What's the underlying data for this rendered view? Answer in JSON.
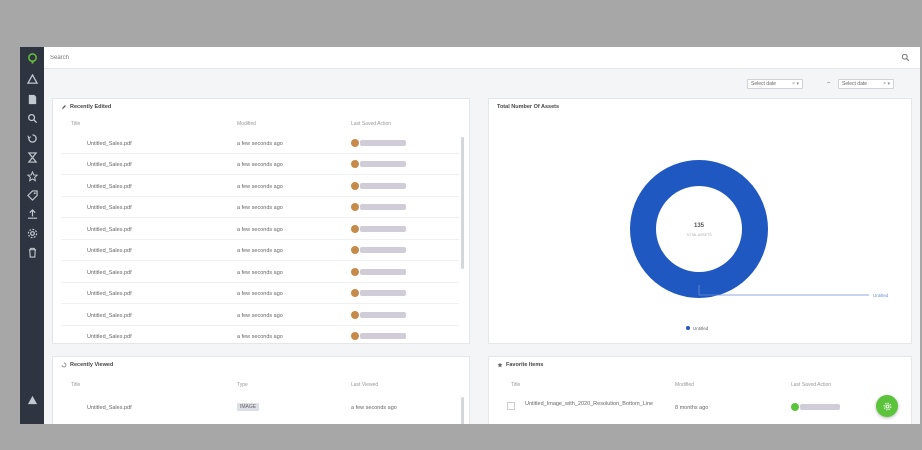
{
  "search": {
    "placeholder": "Search"
  },
  "filters": {
    "from": "Select date",
    "separator": "–",
    "to": "Select date"
  },
  "recently_edited": {
    "title": "Recently Edited",
    "columns": [
      "Title",
      "Modified",
      "Last Saved Action"
    ],
    "rows": [
      {
        "title": "Untitled_Sales.pdf",
        "modified": "a few seconds ago"
      },
      {
        "title": "Untitled_Sales.pdf",
        "modified": "a few seconds ago"
      },
      {
        "title": "Untitled_Sales.pdf",
        "modified": "a few seconds ago"
      },
      {
        "title": "Untitled_Sales.pdf",
        "modified": "a few seconds ago"
      },
      {
        "title": "Untitled_Sales.pdf",
        "modified": "a few seconds ago"
      },
      {
        "title": "Untitled_Sales.pdf",
        "modified": "a few seconds ago"
      },
      {
        "title": "Untitled_Sales.pdf",
        "modified": "a few seconds ago"
      },
      {
        "title": "Untitled_Sales.pdf",
        "modified": "a few seconds ago"
      },
      {
        "title": "Untitled_Sales.pdf",
        "modified": "a few seconds ago"
      },
      {
        "title": "Untitled_Sales.pdf",
        "modified": "a few seconds ago"
      }
    ]
  },
  "donut": {
    "title": "Total Number Of Assets",
    "center_value": "135",
    "center_label": "TOTAL ASSETS",
    "callout_label": "Untitled",
    "legend": "Untitled",
    "colors": {
      "ring": "#1f58c1",
      "line": "#6a8fd6"
    }
  },
  "recently_viewed": {
    "title": "Recently Viewed",
    "columns": [
      "Title",
      "Type",
      "Last Viewed"
    ],
    "rows": [
      {
        "title": "Untitled_Sales.pdf",
        "type": "IMAGE",
        "last_viewed": "a few seconds ago"
      }
    ]
  },
  "favorite_items": {
    "title": "Favorite Items",
    "columns": [
      "Title",
      "Modified",
      "Last Saved Action"
    ],
    "rows": [
      {
        "title": "Untitled_Image_with_2020_Resolution_Bottom_Line",
        "modified": "8 months ago"
      }
    ]
  },
  "colors": {
    "sidebar": "#2e3540",
    "avatar": "#c68a4a",
    "avatar_green": "#5cc33d",
    "fab": "#5cc33d"
  }
}
